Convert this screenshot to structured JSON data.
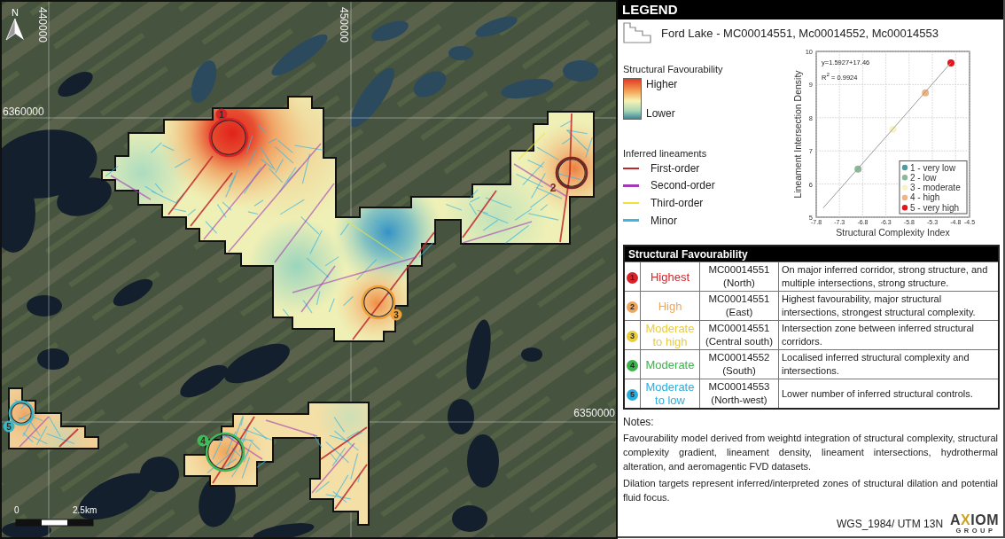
{
  "map": {
    "north_label": "N",
    "eastings": [
      "440000",
      "450000"
    ],
    "northings": [
      "6360000",
      "6350000"
    ],
    "targets": [
      {
        "label": "1",
        "kind": "badge",
        "color": "#d8232a"
      },
      {
        "label": "2",
        "kind": "plain",
        "color": "#7b2424"
      },
      {
        "label": "3",
        "kind": "badge",
        "color": "#efa23a"
      },
      {
        "label": "4",
        "kind": "badge",
        "color": "#3dbb5a"
      },
      {
        "label": "5",
        "kind": "badge",
        "color": "#3ab5c5"
      }
    ],
    "scale_bar": {
      "start": "0",
      "end": "2.5km"
    }
  },
  "legend": {
    "title": "LEGEND",
    "project": "Ford Lake - MC00014551, Mc00014552, Mc00014553",
    "favourability": {
      "title": "Structural Favourability",
      "high": "Higher",
      "low": "Lower"
    },
    "lineaments": {
      "title": "Inferred lineaments",
      "items": [
        {
          "label": "First-order",
          "color": "#c0272d"
        },
        {
          "label": "Second-order",
          "color": "#a23ab6"
        },
        {
          "label": "Third-order",
          "color": "#eee23a"
        },
        {
          "label": "Minor",
          "color": "#3fb6df"
        }
      ]
    },
    "chart_data": {
      "type": "scatter",
      "xlabel": "Structural Complexity Index",
      "ylabel": "Lineament Intersection Density",
      "x": [
        -7.65,
        -6.9,
        -6.15,
        -5.45,
        -4.9
      ],
      "series": [
        {
          "name": "1 - very low",
          "color": "#4e9c9e",
          "values": [
            null,
            null,
            null,
            null,
            null
          ]
        },
        {
          "name": "2 - low",
          "color": "#8db99b",
          "values": [
            null,
            6.45,
            null,
            null,
            null
          ]
        },
        {
          "name": "3 - moderate",
          "color": "#f7f4c4",
          "values": [
            null,
            null,
            7.65,
            null,
            null
          ]
        },
        {
          "name": "4 - high",
          "color": "#ecb584",
          "values": [
            null,
            null,
            null,
            8.75,
            null
          ]
        },
        {
          "name": "5 - very high",
          "color": "#e0161c",
          "values": [
            null,
            null,
            null,
            null,
            9.65
          ]
        },
        {
          "type": "line",
          "color": "#9a9a9a",
          "values": [
            5.28,
            6.47,
            7.66,
            8.78,
            9.66
          ]
        }
      ],
      "xlim": [
        -7.8,
        -4.5
      ],
      "ylim": [
        5,
        10
      ],
      "xticks": [
        -7.8,
        -7.3,
        -6.8,
        -6.3,
        -5.8,
        -5.3,
        -4.8,
        -4.5
      ],
      "yticks": [
        5,
        6,
        7,
        8,
        9,
        10
      ],
      "grid": true,
      "legend": "lower right",
      "annotations": [
        {
          "text": "y=1.5927+17.46"
        },
        {
          "text": "R$^{2}$ = 0.9924"
        }
      ]
    }
  },
  "table": {
    "title": "Structural Favourability",
    "rows": [
      {
        "number": "1",
        "level": "Highest",
        "claim": "MC00014551",
        "area": "(North)",
        "description": "On major inferred corridor, strong structure, and multiple intersections, strong structure.",
        "color": "#d8232a"
      },
      {
        "number": "2",
        "level": "High",
        "claim": "MC00014551",
        "area": "(East)",
        "description": "Highest favourability, major structural intersections, strongest structural complexity.",
        "color": "#efa65e"
      },
      {
        "number": "3",
        "level": "Moderate to high",
        "claim": "MC00014551",
        "area": "(Central south)",
        "description": "Intersection zone between inferred structural corridors.",
        "color": "#e9cc40"
      },
      {
        "number": "4",
        "level": "Moderate",
        "claim": "MC00014552",
        "area": "(South)",
        "description": "Localised inferred structural complexity and intersections.",
        "color": "#3cb44b"
      },
      {
        "number": "5",
        "level": "Moderate to low",
        "claim": "MC00014553",
        "area": "(North-west)",
        "description": "Lower number of inferred structural controls.",
        "color": "#2aaee0"
      }
    ]
  },
  "notes": {
    "title": "Notes:",
    "paragraphs": [
      "Favourability model derived from weightd integration of structural complexity, structural complexity gradient, lineament density, lineament intersections, hydrothermal alteration, and aeromagentic FVD datasets.",
      "Dilation targets represent inferred/interpreted zones of structural dilation and potential fluid focus."
    ]
  },
  "footer": {
    "projection": "WGS_1984/ UTM 13N",
    "logo": {
      "before": "A",
      "mark": "X",
      "after": "IOM",
      "tagline": "GROUP"
    }
  }
}
